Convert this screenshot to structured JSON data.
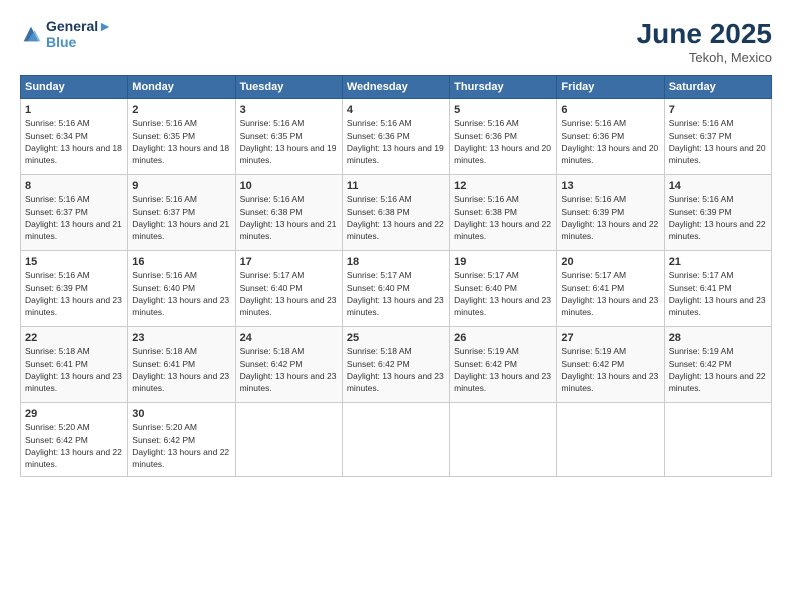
{
  "header": {
    "logo_line1": "General",
    "logo_line2": "Blue",
    "month": "June 2025",
    "location": "Tekoh, Mexico"
  },
  "days_of_week": [
    "Sunday",
    "Monday",
    "Tuesday",
    "Wednesday",
    "Thursday",
    "Friday",
    "Saturday"
  ],
  "weeks": [
    [
      {
        "day": "1",
        "sunrise": "Sunrise: 5:16 AM",
        "sunset": "Sunset: 6:34 PM",
        "daylight": "Daylight: 13 hours and 18 minutes."
      },
      {
        "day": "2",
        "sunrise": "Sunrise: 5:16 AM",
        "sunset": "Sunset: 6:35 PM",
        "daylight": "Daylight: 13 hours and 18 minutes."
      },
      {
        "day": "3",
        "sunrise": "Sunrise: 5:16 AM",
        "sunset": "Sunset: 6:35 PM",
        "daylight": "Daylight: 13 hours and 19 minutes."
      },
      {
        "day": "4",
        "sunrise": "Sunrise: 5:16 AM",
        "sunset": "Sunset: 6:36 PM",
        "daylight": "Daylight: 13 hours and 19 minutes."
      },
      {
        "day": "5",
        "sunrise": "Sunrise: 5:16 AM",
        "sunset": "Sunset: 6:36 PM",
        "daylight": "Daylight: 13 hours and 20 minutes."
      },
      {
        "day": "6",
        "sunrise": "Sunrise: 5:16 AM",
        "sunset": "Sunset: 6:36 PM",
        "daylight": "Daylight: 13 hours and 20 minutes."
      },
      {
        "day": "7",
        "sunrise": "Sunrise: 5:16 AM",
        "sunset": "Sunset: 6:37 PM",
        "daylight": "Daylight: 13 hours and 20 minutes."
      }
    ],
    [
      {
        "day": "8",
        "sunrise": "Sunrise: 5:16 AM",
        "sunset": "Sunset: 6:37 PM",
        "daylight": "Daylight: 13 hours and 21 minutes."
      },
      {
        "day": "9",
        "sunrise": "Sunrise: 5:16 AM",
        "sunset": "Sunset: 6:37 PM",
        "daylight": "Daylight: 13 hours and 21 minutes."
      },
      {
        "day": "10",
        "sunrise": "Sunrise: 5:16 AM",
        "sunset": "Sunset: 6:38 PM",
        "daylight": "Daylight: 13 hours and 21 minutes."
      },
      {
        "day": "11",
        "sunrise": "Sunrise: 5:16 AM",
        "sunset": "Sunset: 6:38 PM",
        "daylight": "Daylight: 13 hours and 22 minutes."
      },
      {
        "day": "12",
        "sunrise": "Sunrise: 5:16 AM",
        "sunset": "Sunset: 6:38 PM",
        "daylight": "Daylight: 13 hours and 22 minutes."
      },
      {
        "day": "13",
        "sunrise": "Sunrise: 5:16 AM",
        "sunset": "Sunset: 6:39 PM",
        "daylight": "Daylight: 13 hours and 22 minutes."
      },
      {
        "day": "14",
        "sunrise": "Sunrise: 5:16 AM",
        "sunset": "Sunset: 6:39 PM",
        "daylight": "Daylight: 13 hours and 22 minutes."
      }
    ],
    [
      {
        "day": "15",
        "sunrise": "Sunrise: 5:16 AM",
        "sunset": "Sunset: 6:39 PM",
        "daylight": "Daylight: 13 hours and 23 minutes."
      },
      {
        "day": "16",
        "sunrise": "Sunrise: 5:16 AM",
        "sunset": "Sunset: 6:40 PM",
        "daylight": "Daylight: 13 hours and 23 minutes."
      },
      {
        "day": "17",
        "sunrise": "Sunrise: 5:17 AM",
        "sunset": "Sunset: 6:40 PM",
        "daylight": "Daylight: 13 hours and 23 minutes."
      },
      {
        "day": "18",
        "sunrise": "Sunrise: 5:17 AM",
        "sunset": "Sunset: 6:40 PM",
        "daylight": "Daylight: 13 hours and 23 minutes."
      },
      {
        "day": "19",
        "sunrise": "Sunrise: 5:17 AM",
        "sunset": "Sunset: 6:40 PM",
        "daylight": "Daylight: 13 hours and 23 minutes."
      },
      {
        "day": "20",
        "sunrise": "Sunrise: 5:17 AM",
        "sunset": "Sunset: 6:41 PM",
        "daylight": "Daylight: 13 hours and 23 minutes."
      },
      {
        "day": "21",
        "sunrise": "Sunrise: 5:17 AM",
        "sunset": "Sunset: 6:41 PM",
        "daylight": "Daylight: 13 hours and 23 minutes."
      }
    ],
    [
      {
        "day": "22",
        "sunrise": "Sunrise: 5:18 AM",
        "sunset": "Sunset: 6:41 PM",
        "daylight": "Daylight: 13 hours and 23 minutes."
      },
      {
        "day": "23",
        "sunrise": "Sunrise: 5:18 AM",
        "sunset": "Sunset: 6:41 PM",
        "daylight": "Daylight: 13 hours and 23 minutes."
      },
      {
        "day": "24",
        "sunrise": "Sunrise: 5:18 AM",
        "sunset": "Sunset: 6:42 PM",
        "daylight": "Daylight: 13 hours and 23 minutes."
      },
      {
        "day": "25",
        "sunrise": "Sunrise: 5:18 AM",
        "sunset": "Sunset: 6:42 PM",
        "daylight": "Daylight: 13 hours and 23 minutes."
      },
      {
        "day": "26",
        "sunrise": "Sunrise: 5:19 AM",
        "sunset": "Sunset: 6:42 PM",
        "daylight": "Daylight: 13 hours and 23 minutes."
      },
      {
        "day": "27",
        "sunrise": "Sunrise: 5:19 AM",
        "sunset": "Sunset: 6:42 PM",
        "daylight": "Daylight: 13 hours and 23 minutes."
      },
      {
        "day": "28",
        "sunrise": "Sunrise: 5:19 AM",
        "sunset": "Sunset: 6:42 PM",
        "daylight": "Daylight: 13 hours and 22 minutes."
      }
    ],
    [
      {
        "day": "29",
        "sunrise": "Sunrise: 5:20 AM",
        "sunset": "Sunset: 6:42 PM",
        "daylight": "Daylight: 13 hours and 22 minutes."
      },
      {
        "day": "30",
        "sunrise": "Sunrise: 5:20 AM",
        "sunset": "Sunset: 6:42 PM",
        "daylight": "Daylight: 13 hours and 22 minutes."
      },
      null,
      null,
      null,
      null,
      null
    ]
  ]
}
